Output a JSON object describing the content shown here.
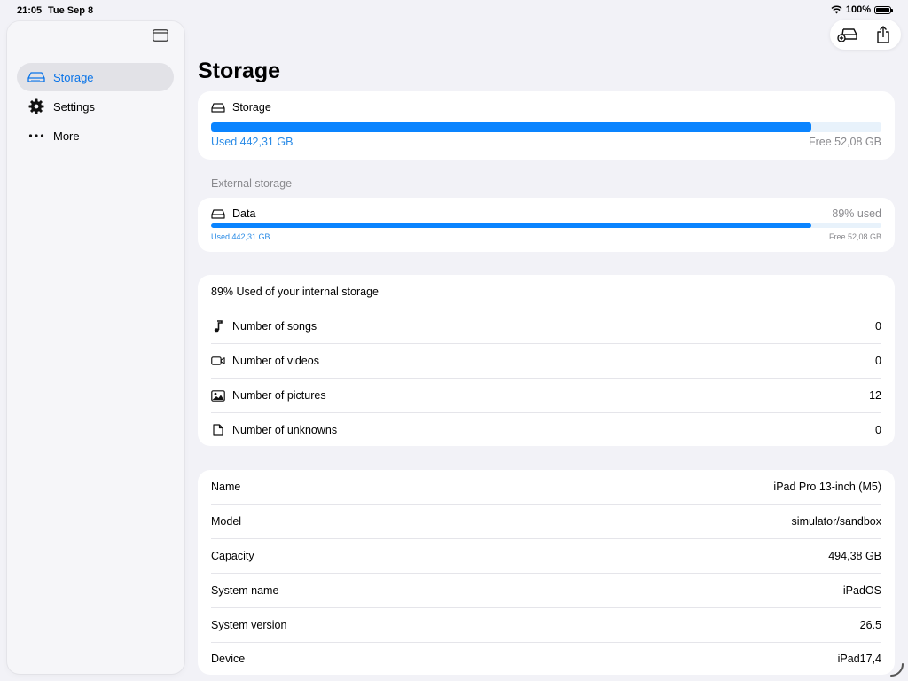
{
  "status": {
    "time": "21:05",
    "date": "Tue Sep 8",
    "battery": "100%"
  },
  "sidebar": {
    "items": [
      {
        "label": "Storage",
        "icon": "drive-icon",
        "selected": true
      },
      {
        "label": "Settings",
        "icon": "gear-icon",
        "selected": false
      },
      {
        "label": "More",
        "icon": "ellipsis-icon",
        "selected": false
      }
    ]
  },
  "page": {
    "title": "Storage"
  },
  "internal": {
    "title": "Storage",
    "used": "Used 442,31 GB",
    "free": "Free 52,08 GB",
    "fraction": 0.895
  },
  "external": {
    "header": "External storage",
    "title": "Data",
    "percent_used": "89% used",
    "used": "Used 442,31 GB",
    "free": "Free 52,08 GB",
    "fraction": 0.895
  },
  "stats": {
    "summary": "89% Used of your internal storage",
    "rows": [
      {
        "icon": "music-note-icon",
        "label": "Number of songs",
        "value": "0"
      },
      {
        "icon": "video-camera-icon",
        "label": "Number of videos",
        "value": "0"
      },
      {
        "icon": "photo-icon",
        "label": "Number of pictures",
        "value": "12"
      },
      {
        "icon": "document-icon",
        "label": "Number of unknowns",
        "value": "0"
      }
    ]
  },
  "device": {
    "rows": [
      {
        "label": "Name",
        "value": "iPad Pro 13-inch (M5)"
      },
      {
        "label": "Model",
        "value": "simulator/sandbox"
      },
      {
        "label": "Capacity",
        "value": "494,38 GB"
      },
      {
        "label": "System name",
        "value": "iPadOS"
      },
      {
        "label": "System version",
        "value": "26.5"
      },
      {
        "label": "Device",
        "value": "iPad17,4"
      }
    ]
  },
  "colors": {
    "accent": "#0a84ff",
    "background": "#f2f2f7",
    "secondary_text": "#8a8a8e"
  }
}
